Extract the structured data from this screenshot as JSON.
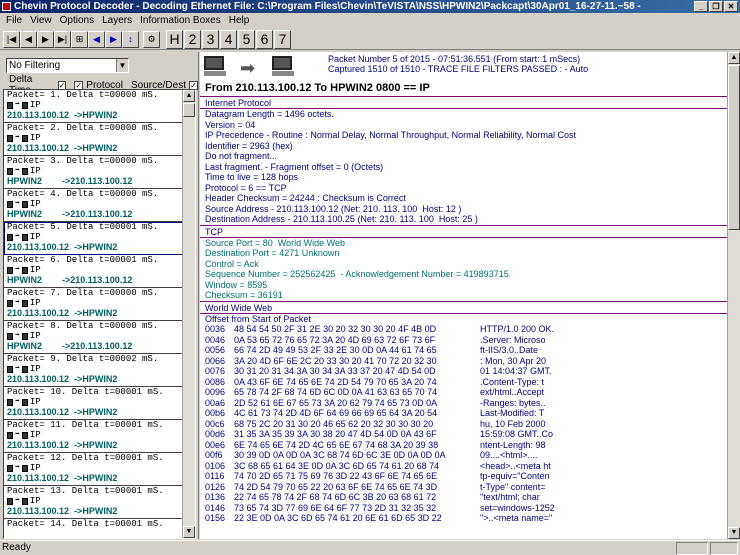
{
  "window": {
    "title": "Chevin Protocol Decoder - Decoding Ethernet File: C:\\Program Files\\Chevin\\TeVISTA\\NSS\\HPWIN2\\Packcapt\\30Apr01_16-27-11.~58 -",
    "minimize": "_",
    "restore": "❐",
    "close": "✕"
  },
  "menu": [
    "File",
    "View",
    "Options",
    "Layers",
    "Information Boxes",
    "Help"
  ],
  "toolbar": {
    "first": "|◀",
    "prev": "◀",
    "next": "▶",
    "last": "▶|",
    "tool1": "⊞",
    "blue_prev": "◀",
    "blue_next": "▶",
    "tool2": "↕",
    "tool3": "⚙",
    "layer_buttons": [
      "H",
      "2",
      "3",
      "4",
      "5",
      "6",
      "7"
    ]
  },
  "left": {
    "filter_value": "No Filtering",
    "filter_arrow": "▼",
    "check_delta": "Delta Time",
    "check_protocol": "Protocol",
    "check_source": "Source/Dest",
    "checkmark": "✓",
    "packets": [
      {
        "head": "Packet= 1. Delta t=00000 mS.",
        "proto": "IP",
        "route": "210.113.100.12  ->HPWIN2"
      },
      {
        "head": "Packet= 2. Delta t=00000 mS.",
        "proto": "IP",
        "route": "210.113.100.12  ->HPWIN2"
      },
      {
        "head": "Packet= 3. Delta t=00000 mS.",
        "proto": "IP",
        "route": "HPWIN2        ->210.113.100.12"
      },
      {
        "head": "Packet= 4. Delta t=00000 mS.",
        "proto": "IP",
        "route": "HPWIN2        ->210.113.100.12"
      },
      {
        "head": "Packet= 5. Delta t=00001 mS.",
        "proto": "IP",
        "route": "210.113.100.12  ->HPWIN2"
      },
      {
        "head": "Packet= 6. Delta t=00001 mS.",
        "proto": "IP",
        "route": "HPWIN2        ->210.113.100.12"
      },
      {
        "head": "Packet= 7. Delta t=00000 mS.",
        "proto": "IP",
        "route": "210.113.100.12  ->HPWIN2"
      },
      {
        "head": "Packet= 8. Delta t=00000 mS.",
        "proto": "IP",
        "route": "HPWIN2        ->210.113.100.12"
      },
      {
        "head": "Packet= 9. Delta t=00002 mS.",
        "proto": "IP",
        "route": "210.113.100.12  ->HPWIN2"
      },
      {
        "head": "Packet= 10. Delta t=00001 mS.",
        "proto": "IP",
        "route": "210.113.100.12  ->HPWIN2"
      },
      {
        "head": "Packet= 11. Delta t=00001 mS.",
        "proto": "IP",
        "route": "210.113.100.12  ->HPWIN2"
      },
      {
        "head": "Packet= 12. Delta t=00001 mS.",
        "proto": "IP",
        "route": "210.113.100.12  ->HPWIN2"
      },
      {
        "head": "Packet= 13. Delta t=00001 mS.",
        "proto": "IP",
        "route": "210.113.100.12  ->HPWIN2"
      },
      {
        "head": "Packet= 14. Delta t=00001 mS.",
        "proto": "",
        "route": ""
      }
    ],
    "selected_index": 4
  },
  "right": {
    "packet_info_1": "Packet Number 5 of 2015 - 07:51:36.551  (From start: 1 mSecs)",
    "packet_info_2": "Captured 1510 of 1510  -   TRACE FILE FILTERS PASSED : - Auto",
    "route_title": "From 210.113.100.12 To HPWIN2 0800 == IP",
    "ip_head": "Internet Protocol",
    "ip_lines": [
      "Datagram Length = 1496 octets.",
      "Version = 04",
      "IP Precedence - Routine : Normal Delay, Normal Throughput, Normal Reliability, Normal Cost",
      "Identifier = 2963 (hex)",
      "Do not fragment...",
      "Last fragment. - Fragment offset = 0 (Octets)",
      "Time to live = 128 hops",
      "Protocol = 6 == TCP",
      "Header Checksum = 24244 : Checksum is Correct",
      "Source Address - 210.113.100.12 (Net: 210. 113. 100  Host: 12 )",
      "Destination Address - 210.113.100.25 (Net: 210. 113. 100  Host: 25 )"
    ],
    "tcp_head": "TCP",
    "tcp_lines": [
      "Source Port = 80  World Wide Web",
      "Destination Port = 4271 Unknown",
      "Control = Ack",
      "Sequence Number = 252562425  - Acknowledgement Number = 419893715",
      "Window = 8595",
      "Checksum = 36191"
    ],
    "www_head": "World Wide Web",
    "offset_label": "Offset from Start of Packet",
    "hex_rows": [
      {
        "off": "0036",
        "hex": "48 54 54 50 2F 31 2E 30 20 32 30 30 20 4F 4B 0D",
        "asc": "HTTP/1.0 200 OK."
      },
      {
        "off": "0046",
        "hex": "0A 53 65 72 76 65 72 3A 20 4D 69 63 72 6F 73 6F",
        "asc": ".Server: Microso"
      },
      {
        "off": "0056",
        "hex": "66 74 2D 49 49 53 2F 33 2E 30 0D 0A 44 61 74 65",
        "asc": "ft-IIS/3.0..Date"
      },
      {
        "off": "0066",
        "hex": "3A 20 4D 6F 6E 2C 20 33 30 20 41 70 72 20 32 30",
        "asc": ": Mon, 30 Apr 20"
      },
      {
        "off": "0076",
        "hex": "30 31 20 31 34 3A 30 34 3A 33 37 20 47 4D 54 0D",
        "asc": "01 14:04:37 GMT."
      },
      {
        "off": "0086",
        "hex": "0A 43 6F 6E 74 65 6E 74 2D 54 79 70 65 3A 20 74",
        "asc": ".Content-Type: t"
      },
      {
        "off": "0096",
        "hex": "65 78 74 2F 68 74 6D 6C 0D 0A 41 63 63 65 70 74",
        "asc": "ext/html..Accept"
      },
      {
        "off": "00a6",
        "hex": "2D 52 61 6E 67 65 73 3A 20 62 79 74 65 73 0D 0A",
        "asc": "-Ranges: bytes.."
      },
      {
        "off": "00b6",
        "hex": "4C 61 73 74 2D 4D 6F 64 69 66 69 65 64 3A 20 54",
        "asc": "Last-Modified: T"
      },
      {
        "off": "00c6",
        "hex": "68 75 2C 20 31 30 20 46 65 62 20 32 30 30 30 20",
        "asc": "hu, 10 Feb 2000"
      },
      {
        "off": "00d6",
        "hex": "31 35 3A 35 39 3A 30 38 20 47 4D 54 0D 0A 43 6F",
        "asc": "15:59:08 GMT..Co"
      },
      {
        "off": "00e6",
        "hex": "6E 74 65 6E 74 2D 4C 65 6E 67 74 68 3A 20 39 38",
        "asc": "ntent-Length: 98"
      },
      {
        "off": "00f6",
        "hex": "30 39 0D 0A 0D 0A 3C 68 74 6D 6C 3E 0D 0A 0D 0A",
        "asc": "09....<html>...."
      },
      {
        "off": "0106",
        "hex": "3C 68 65 61 64 3E 0D 0A 3C 6D 65 74 61 20 68 74",
        "asc": "<head>..<meta ht"
      },
      {
        "off": "0116",
        "hex": "74 70 2D 65 71 75 69 76 3D 22 43 6F 6E 74 65 6E",
        "asc": "tp-equiv=\"Conten"
      },
      {
        "off": "0126",
        "hex": "74 2D 54 79 70 65 22 20 63 6F 6E 74 65 6E 74 3D",
        "asc": "t-Type\" content="
      },
      {
        "off": "0136",
        "hex": "22 74 65 78 74 2F 68 74 6D 6C 3B 20 63 68 61 72",
        "asc": "\"text/html; char"
      },
      {
        "off": "0146",
        "hex": "73 65 74 3D 77 69 6E 64 6F 77 73 2D 31 32 35 32",
        "asc": "set=windows-1252"
      },
      {
        "off": "0156",
        "hex": "22 3E 0D 0A 3C 6D 65 74 61 20 6E 61 6D 65 3D 22",
        "asc": "\">..<meta name=\""
      }
    ]
  },
  "status": "Ready",
  "scroll": {
    "up": "▲",
    "down": "▼"
  }
}
